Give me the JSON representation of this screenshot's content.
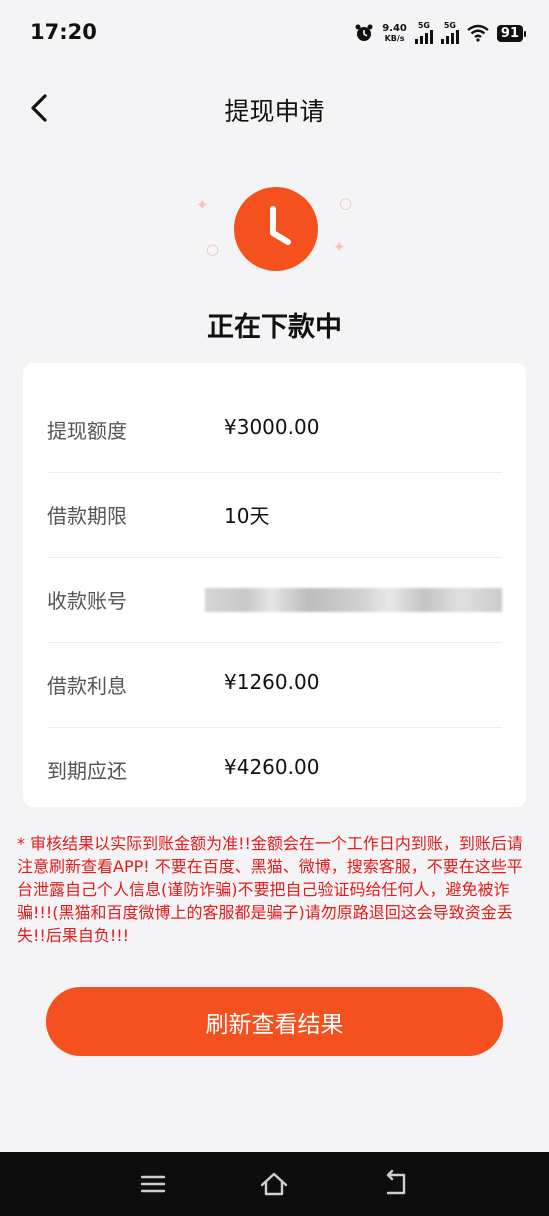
{
  "status_bar": {
    "time": "17:20",
    "net_speed_value": "9.40",
    "net_speed_unit": "KB/s",
    "sim1_label": "5G",
    "sim2_label": "5G",
    "battery": "91"
  },
  "header": {
    "title": "提现申请"
  },
  "status": {
    "text": "正在下款中"
  },
  "details": [
    {
      "label": "提现额度",
      "value": "¥3000.00"
    },
    {
      "label": "借款期限",
      "value": "10天"
    },
    {
      "label": "收款账号",
      "value": ""
    },
    {
      "label": "借款利息",
      "value": "¥1260.00"
    },
    {
      "label": "到期应还",
      "value": "¥4260.00"
    }
  ],
  "notice": "* 审核结果以实际到账金额为准!!金额会在一个工作日内到账，到账后请注意刷新查看APP! 不要在百度、黑猫、微博，搜索客服，不要在这些平台泄露自己个人信息(谨防诈骗)不要把自己验证码给任何人，避免被诈骗!!!(黑猫和百度微博上的客服都是骗子)请勿原路退回这会导致资金丢失!!后果自负!!!",
  "actions": {
    "refresh_label": "刷新查看结果"
  },
  "colors": {
    "accent": "#f4511e",
    "notice": "#e41b1b",
    "background": "#f4f4f6"
  }
}
